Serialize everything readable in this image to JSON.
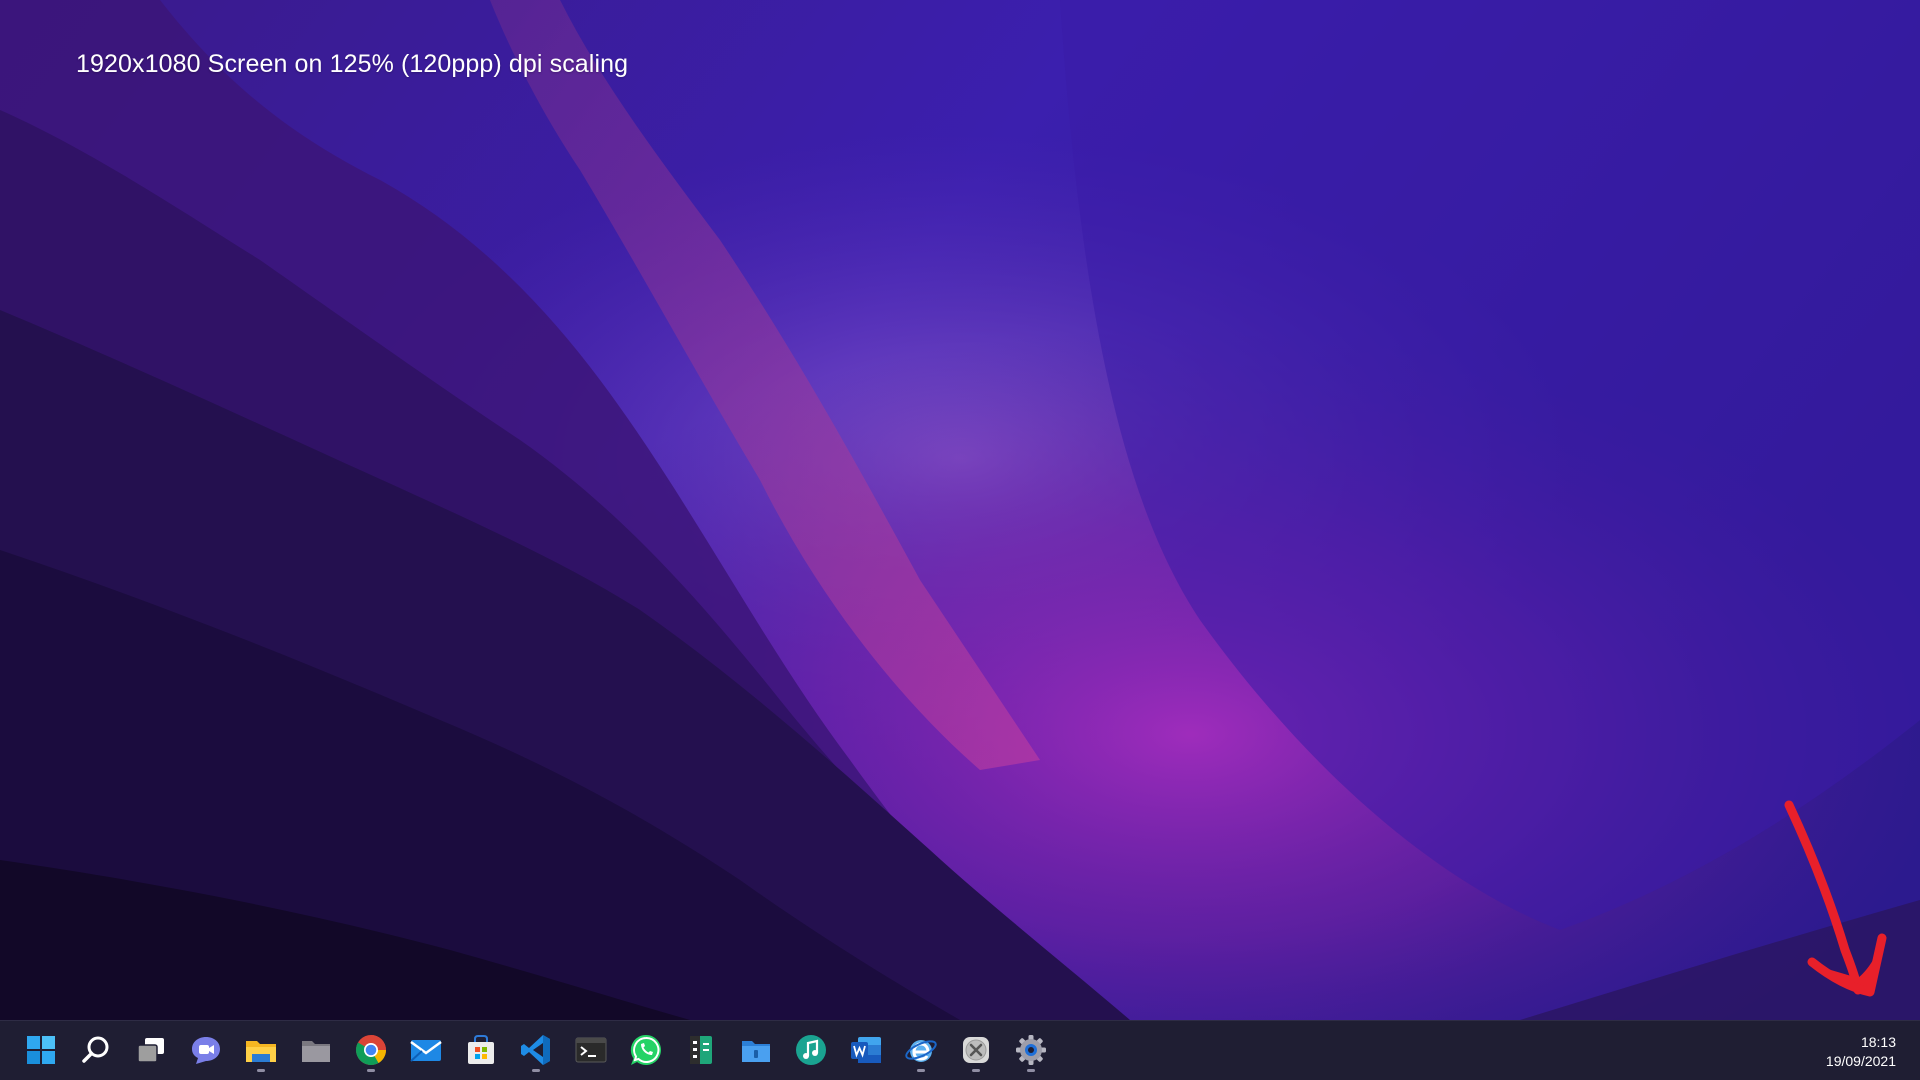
{
  "desktop": {
    "caption": "1920x1080 Screen on 125% (120ppp) dpi scaling",
    "annotation_arrow_color": "#e8202a"
  },
  "taskbar": {
    "background": "#1f1e33",
    "items": [
      {
        "name": "start-button",
        "icon": "windows-logo-icon",
        "running": false
      },
      {
        "name": "search-button",
        "icon": "search-icon",
        "running": false
      },
      {
        "name": "task-view-button",
        "icon": "task-view-icon",
        "running": false
      },
      {
        "name": "chat-button",
        "icon": "teams-chat-icon",
        "running": false
      },
      {
        "name": "file-explorer-button",
        "icon": "folder-icon",
        "running": true
      },
      {
        "name": "files-app-button",
        "icon": "grey-folder-icon",
        "running": false
      },
      {
        "name": "chrome-button",
        "icon": "chrome-icon",
        "running": true
      },
      {
        "name": "mail-button",
        "icon": "mail-icon",
        "running": false
      },
      {
        "name": "store-button",
        "icon": "store-icon",
        "running": false
      },
      {
        "name": "vscode-button",
        "icon": "vscode-icon",
        "running": true
      },
      {
        "name": "terminal-button",
        "icon": "terminal-icon",
        "running": false
      },
      {
        "name": "whatsapp-button",
        "icon": "whatsapp-icon",
        "running": false
      },
      {
        "name": "calculator-app-button",
        "icon": "green-calculator-icon",
        "running": false
      },
      {
        "name": "folder-app-button",
        "icon": "blue-folder-icon",
        "running": false
      },
      {
        "name": "music-app-button",
        "icon": "music-note-icon",
        "running": false
      },
      {
        "name": "word-button",
        "icon": "word-icon",
        "running": false
      },
      {
        "name": "browser-e-button",
        "icon": "globe-e-icon",
        "running": true
      },
      {
        "name": "close-app-button",
        "icon": "x-circle-icon",
        "running": true
      },
      {
        "name": "settings-button",
        "icon": "gear-icon",
        "running": true
      }
    ]
  },
  "clock": {
    "time": "18:13",
    "date": "19/09/2021"
  }
}
